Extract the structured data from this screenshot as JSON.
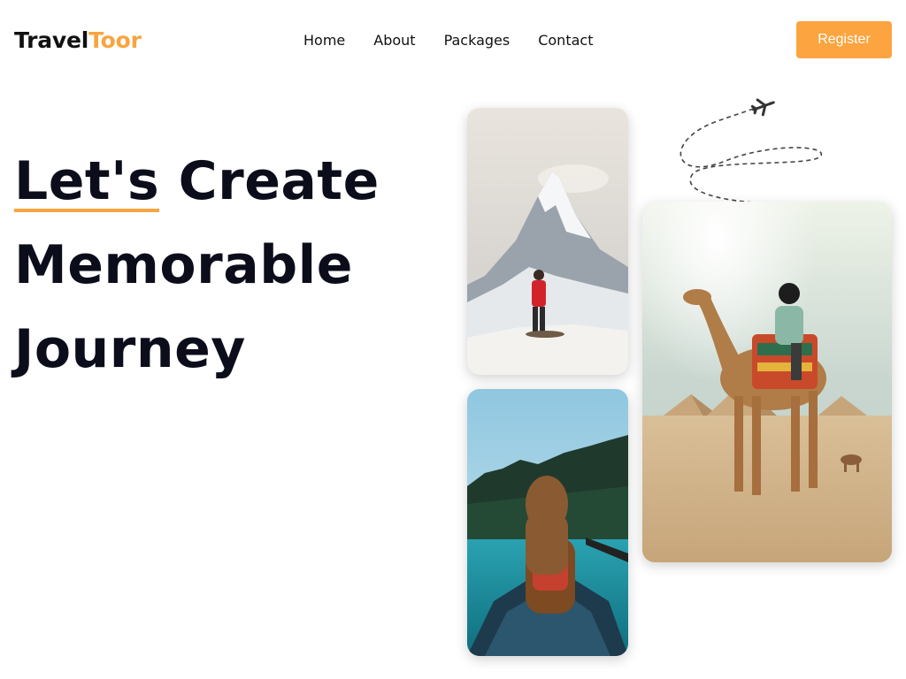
{
  "brand": {
    "name_part1": "Travel",
    "name_part2": "Toor",
    "accent_color": "#f7a541"
  },
  "nav": {
    "items": [
      {
        "label": "Home"
      },
      {
        "label": "About"
      },
      {
        "label": "Packages"
      },
      {
        "label": "Contact"
      }
    ]
  },
  "header": {
    "register_label": "Register",
    "register_color": "#fca43f"
  },
  "hero": {
    "word1": "Let's",
    "word2": "Create",
    "line2": "Memorable",
    "line3": "Journey",
    "underline_color": "#f7a541"
  },
  "gallery": {
    "images": [
      {
        "subject": "hiker-on-snowy-mountain"
      },
      {
        "subject": "woman-in-canoe-on-lake"
      },
      {
        "subject": "person-riding-camel-near-pyramids"
      }
    ],
    "decoration": "airplane-icon"
  }
}
